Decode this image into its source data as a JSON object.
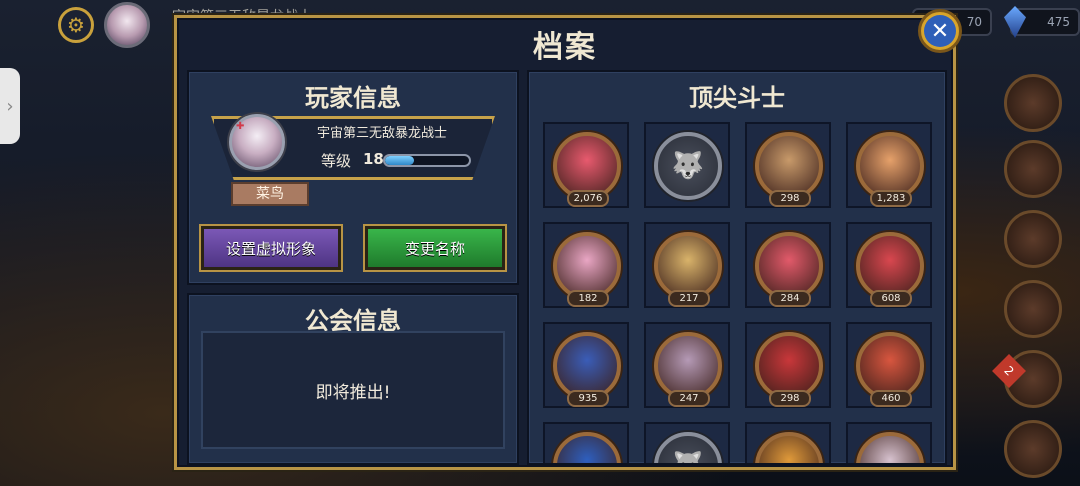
{
  "background": {
    "player_name_faded": "宇宙第三无敌暴龙战士",
    "currency_a": "70",
    "currency_b": "475",
    "side_badge": "2"
  },
  "panel": {
    "title": "档案",
    "close_icon": "close-icon"
  },
  "player_info": {
    "heading": "玩家信息",
    "name": "宇宙第三无敌暴龙战士",
    "level_label": "等级",
    "level": "18",
    "xp_fraction": 0.35,
    "rank": "菜鸟",
    "buttons": {
      "set_avatar": "设置虚拟形象",
      "rename": "变更名称"
    }
  },
  "guild_info": {
    "heading": "公会信息",
    "message": "即将推出!"
  },
  "top_fighters": {
    "heading": "顶尖斗士",
    "items": [
      {
        "count": "2,076",
        "locked": false,
        "color": "#e85a6e"
      },
      {
        "count": "",
        "locked": true,
        "color": "#8a8f9b"
      },
      {
        "count": "298",
        "locked": false,
        "color": "#c89a6a"
      },
      {
        "count": "1,283",
        "locked": false,
        "color": "#e6a16a"
      },
      {
        "count": "182",
        "locked": false,
        "color": "#e9a6c4"
      },
      {
        "count": "217",
        "locked": false,
        "color": "#d9b36a"
      },
      {
        "count": "284",
        "locked": false,
        "color": "#e25a6a"
      },
      {
        "count": "608",
        "locked": false,
        "color": "#d9474f"
      },
      {
        "count": "935",
        "locked": false,
        "color": "#3a5db8"
      },
      {
        "count": "247",
        "locked": false,
        "color": "#b59ab6"
      },
      {
        "count": "298",
        "locked": false,
        "color": "#c9373a"
      },
      {
        "count": "460",
        "locked": false,
        "color": "#d8563f"
      },
      {
        "count": "",
        "locked": false,
        "color": "#2e5fbf"
      },
      {
        "count": "",
        "locked": true,
        "color": "#8a8f9b"
      },
      {
        "count": "",
        "locked": false,
        "color": "#e09a3a"
      },
      {
        "count": "",
        "locked": false,
        "color": "#d7c2cf"
      }
    ]
  }
}
